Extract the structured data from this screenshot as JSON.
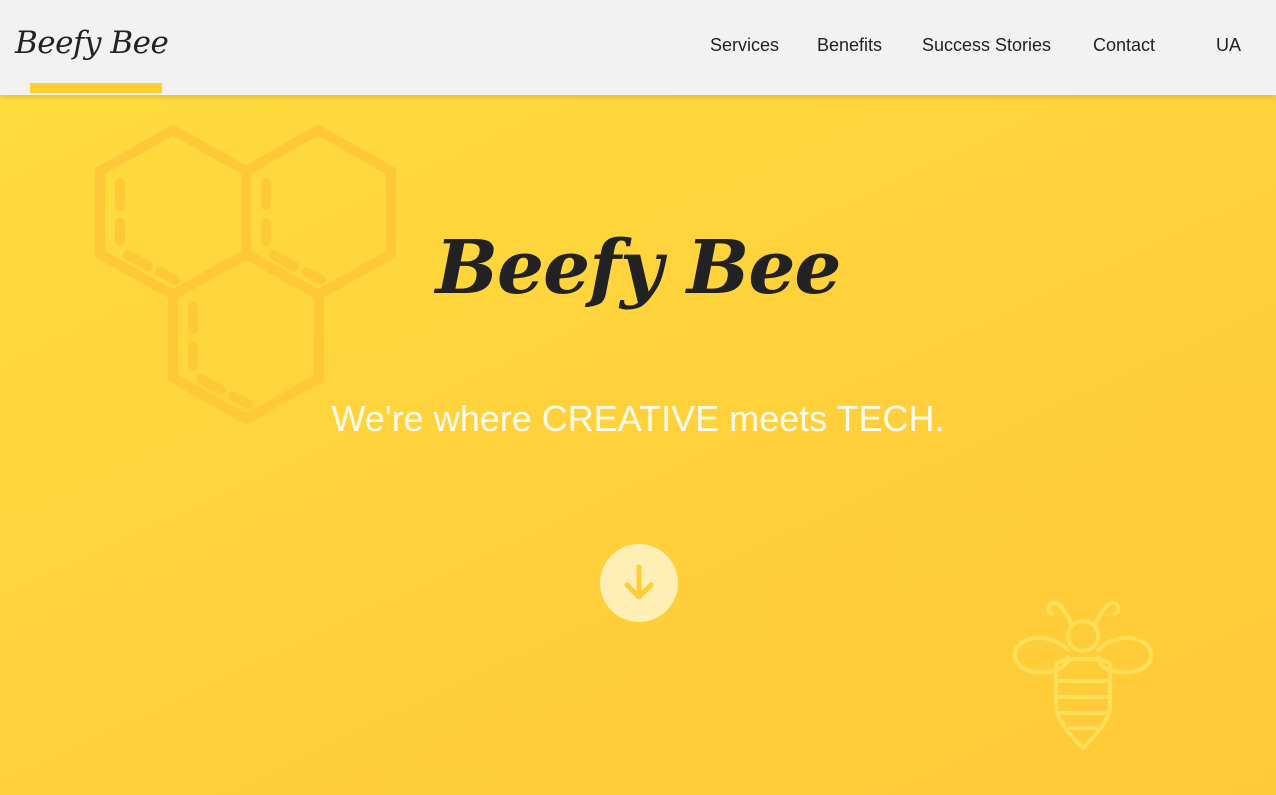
{
  "header": {
    "logo": "Beefy Bee",
    "nav": [
      {
        "label": "Services"
      },
      {
        "label": "Benefits"
      },
      {
        "label": "Success Stories"
      },
      {
        "label": "Contact"
      },
      {
        "label": "UA"
      }
    ]
  },
  "hero": {
    "title": "Beefy Bee",
    "subtitle": "We're where CREATIVE meets TECH.",
    "scroll_icon": "arrow-down-icon",
    "decor_icons": [
      "honeycomb-icon",
      "bee-icon"
    ]
  },
  "colors": {
    "header_bg": "#f2f2f2",
    "hero_bg": "#ffd23c",
    "accent": "#ffcf33",
    "text": "#222222",
    "subtitle": "#ffffff"
  }
}
